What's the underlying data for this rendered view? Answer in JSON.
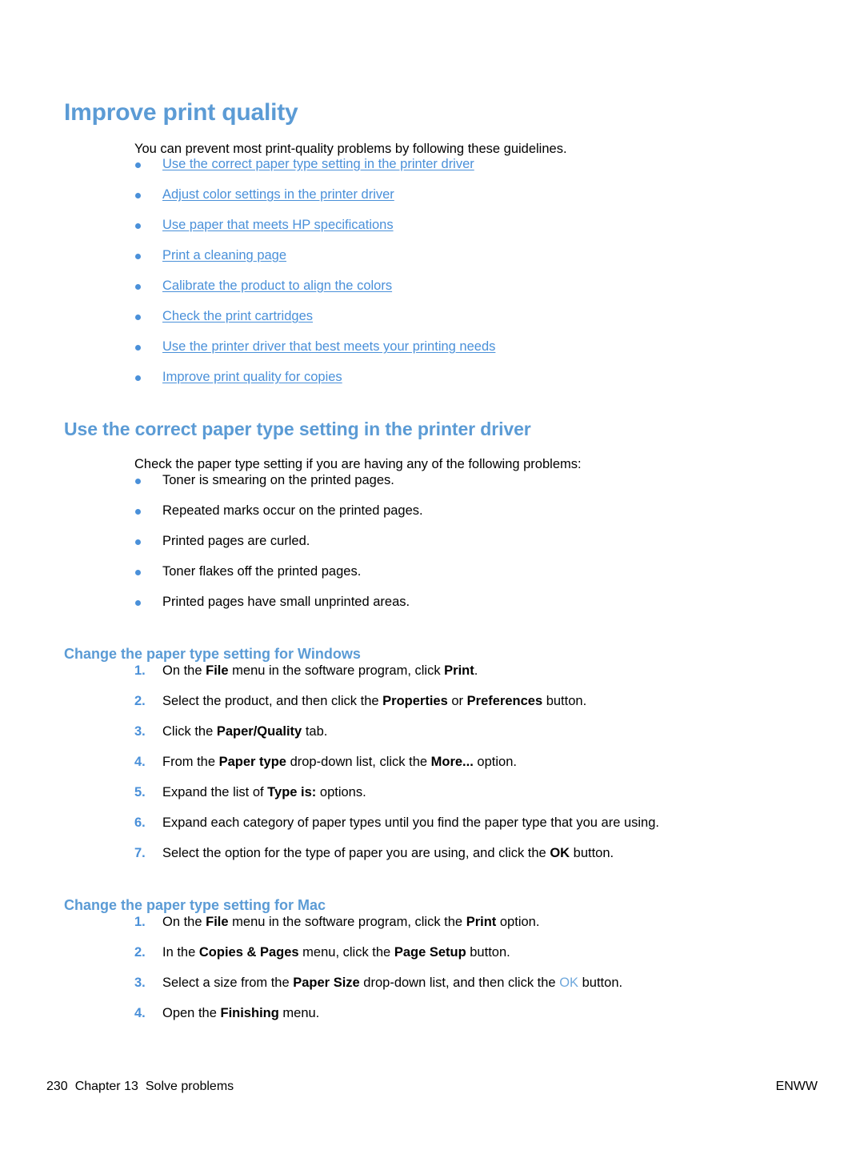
{
  "document": {
    "page_number": "230",
    "chapter": "Chapter 13",
    "chapter_title": "Solve problems",
    "footer_right": "ENWW",
    "accent_color": "#5B9BD5",
    "link_color": "#4A90D9",
    "text_color": "#000000",
    "background_color": "#FFFFFF"
  },
  "h1": {
    "title": "Improve print quality"
  },
  "intro": {
    "paragraph": "You can prevent most print-quality problems by following these guidelines."
  },
  "toc_links": [
    {
      "label": "Use the correct paper type setting in the printer driver"
    },
    {
      "label": "Adjust color settings in the printer driver"
    },
    {
      "label": "Use paper that meets HP specifications"
    },
    {
      "label": "Print a cleaning page"
    },
    {
      "label": "Calibrate the product to align the colors"
    },
    {
      "label": "Check the print cartridges"
    },
    {
      "label": "Use the printer driver that best meets your printing needs"
    },
    {
      "label": "Improve print quality for copies"
    }
  ],
  "section_paper_type": {
    "heading": "Use the correct paper type setting in the printer driver",
    "intro": "Check the paper type setting if you are having any of the following problems:",
    "problems": [
      {
        "label": "Toner is smearing on the printed pages."
      },
      {
        "label": "Repeated marks occur on the printed pages."
      },
      {
        "label": "Printed pages are curled."
      },
      {
        "label": "Toner flakes off the printed pages."
      },
      {
        "label": "Printed pages have small unprinted areas."
      }
    ]
  },
  "section_windows": {
    "heading": "Change the paper type setting for Windows",
    "steps": [
      {
        "number": "1.",
        "parts": [
          {
            "text": "On the ",
            "style": "normal"
          },
          {
            "text": "File",
            "style": "bold"
          },
          {
            "text": " menu in the software program, click ",
            "style": "normal"
          },
          {
            "text": "Print",
            "style": "bold"
          },
          {
            "text": ".",
            "style": "normal"
          }
        ]
      },
      {
        "number": "2.",
        "parts": [
          {
            "text": "Select the product, and then click the ",
            "style": "normal"
          },
          {
            "text": "Properties",
            "style": "bold"
          },
          {
            "text": " or ",
            "style": "normal"
          },
          {
            "text": "Preferences",
            "style": "bold"
          },
          {
            "text": " button.",
            "style": "normal"
          }
        ]
      },
      {
        "number": "3.",
        "parts": [
          {
            "text": "Click the ",
            "style": "normal"
          },
          {
            "text": "Paper/Quality",
            "style": "bold"
          },
          {
            "text": " tab.",
            "style": "normal"
          }
        ]
      },
      {
        "number": "4.",
        "parts": [
          {
            "text": "From the ",
            "style": "normal"
          },
          {
            "text": "Paper type",
            "style": "bold"
          },
          {
            "text": " drop-down list, click the ",
            "style": "normal"
          },
          {
            "text": "More...",
            "style": "bold"
          },
          {
            "text": " option.",
            "style": "normal"
          }
        ]
      },
      {
        "number": "5.",
        "parts": [
          {
            "text": "Expand the list of ",
            "style": "normal"
          },
          {
            "text": "Type is:",
            "style": "bold"
          },
          {
            "text": " options.",
            "style": "normal"
          }
        ]
      },
      {
        "number": "6.",
        "parts": [
          {
            "text": "Expand each category of paper types until you find the paper type that you are using.",
            "style": "normal"
          }
        ]
      },
      {
        "number": "7.",
        "parts": [
          {
            "text": "Select the option for the type of paper you are using, and click the ",
            "style": "normal"
          },
          {
            "text": "OK",
            "style": "bold"
          },
          {
            "text": " button.",
            "style": "normal"
          }
        ]
      }
    ]
  },
  "section_mac": {
    "heading": "Change the paper type setting for Mac",
    "steps": [
      {
        "number": "1.",
        "parts": [
          {
            "text": "On the ",
            "style": "normal"
          },
          {
            "text": "File",
            "style": "bold"
          },
          {
            "text": " menu in the software program, click the ",
            "style": "normal"
          },
          {
            "text": "Print",
            "style": "bold"
          },
          {
            "text": " option.",
            "style": "normal"
          }
        ]
      },
      {
        "number": "2.",
        "parts": [
          {
            "text": "In the ",
            "style": "normal"
          },
          {
            "text": "Copies & Pages",
            "style": "bold"
          },
          {
            "text": " menu, click the ",
            "style": "normal"
          },
          {
            "text": "Page Setup",
            "style": "bold"
          },
          {
            "text": " button.",
            "style": "normal"
          }
        ]
      },
      {
        "number": "3.",
        "parts": [
          {
            "text": "Select a size from the ",
            "style": "normal"
          },
          {
            "text": "Paper Size",
            "style": "bold"
          },
          {
            "text": " drop-down list, and then click the ",
            "style": "normal"
          },
          {
            "text": "OK",
            "style": "blue"
          },
          {
            "text": " button.",
            "style": "normal"
          }
        ]
      },
      {
        "number": "4.",
        "parts": [
          {
            "text": "Open the ",
            "style": "normal"
          },
          {
            "text": "Finishing",
            "style": "bold"
          },
          {
            "text": " menu.",
            "style": "normal"
          }
        ]
      }
    ]
  }
}
